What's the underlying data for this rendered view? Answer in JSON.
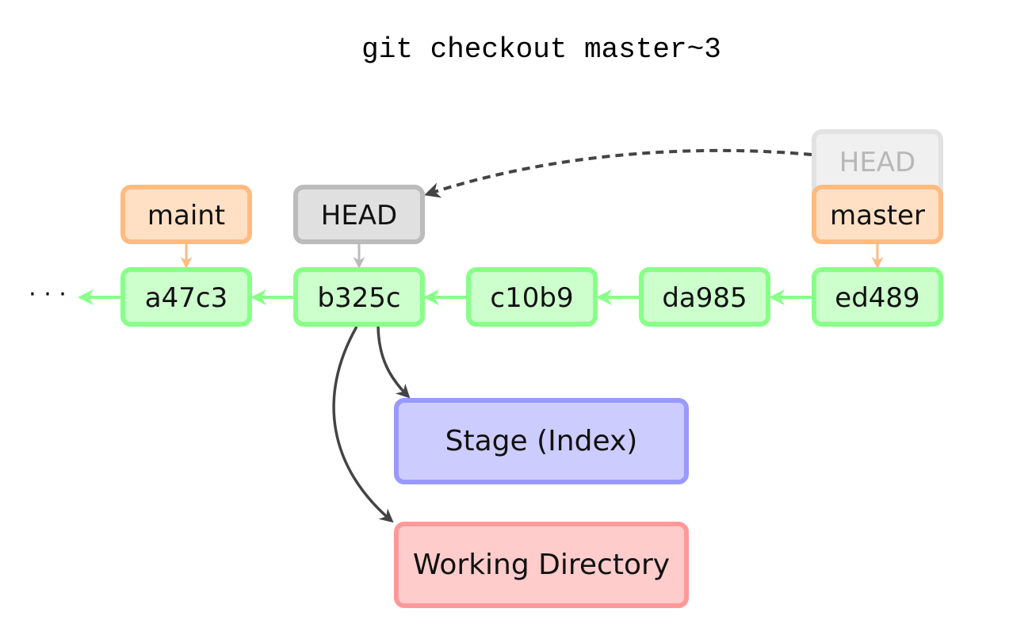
{
  "title": "git checkout master~3",
  "ellipsis": "· · ·",
  "colors": {
    "commit_fill": "#ccffcc",
    "commit_stroke": "#88ff88",
    "branch_fill": "#ffe0c4",
    "branch_stroke": "#ffbb80",
    "head_fill": "#e0e0e0",
    "head_stroke": "#bbbbbb",
    "old_head_fill": "#f0f0f0",
    "old_head_stroke": "#e2e2e2",
    "stage_fill": "#ccccff",
    "stage_stroke": "#9999ff",
    "workdir_fill": "#ffcccc",
    "workdir_stroke": "#ff9999",
    "arrow_dark": "#444444"
  },
  "commits": [
    {
      "id": "a47c3"
    },
    {
      "id": "b325c"
    },
    {
      "id": "c10b9"
    },
    {
      "id": "da985"
    },
    {
      "id": "ed489"
    }
  ],
  "refs": {
    "maint": {
      "label": "maint",
      "points_to": "a47c3"
    },
    "head": {
      "label": "HEAD",
      "points_to": "b325c"
    },
    "master": {
      "label": "master",
      "points_to": "ed489"
    },
    "old_head": {
      "label": "HEAD",
      "previously_at": "master"
    }
  },
  "areas": {
    "stage": {
      "label": "Stage (Index)"
    },
    "workdir": {
      "label": "Working Directory"
    }
  }
}
